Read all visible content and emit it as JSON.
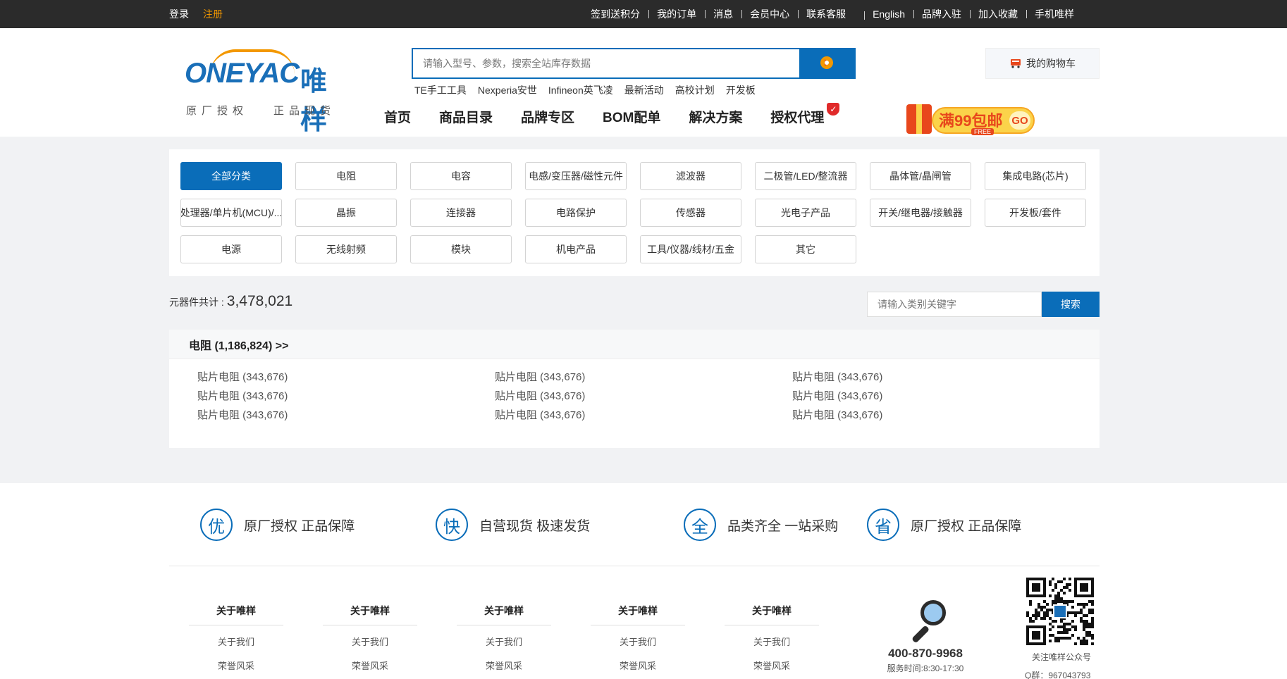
{
  "topbar": {
    "login": "登录",
    "register": "注册",
    "links": [
      "签到送积分",
      "我的订单",
      "消息",
      "会员中心",
      "联系客服",
      "English",
      "品牌入驻",
      "加入收藏",
      "手机唯样"
    ]
  },
  "logo": {
    "brand": "ONEYAC",
    "brand_cn": "唯样",
    "slogan_left": "原厂授权",
    "slogan_right": "正品现货"
  },
  "search": {
    "placeholder": "请输入型号、参数，搜索全站库存数据",
    "button_icon": "search-flame-icon",
    "hotwords": [
      "TE手工工具",
      "Nexperia安世",
      "Infineon英飞凌",
      "最新活动",
      "高校计划",
      "开发板"
    ]
  },
  "nav": {
    "items": [
      "首页",
      "商品目录",
      "品牌专区",
      "BOM配单",
      "解决方案",
      "授权代理"
    ]
  },
  "cart": {
    "label": "我的购物车",
    "icon": "shopping-cart-icon"
  },
  "promo": {
    "text": "满99包邮",
    "go": "GO",
    "free": "FREE"
  },
  "categories": [
    "全部分类",
    "电阻",
    "电容",
    "电感/变压器/磁性元件",
    "滤波器",
    "二极管/LED/整流器",
    "晶体管/晶闸管",
    "集成电路(芯片)",
    "处理器/单片机(MCU)/...",
    "晶振",
    "连接器",
    "电路保护",
    "传感器",
    "光电子产品",
    "开关/继电器/接触器",
    "开发板/套件",
    "电源",
    "无线射频",
    "模块",
    "机电产品",
    "工具/仪器/线材/五金",
    "其它"
  ],
  "summary": {
    "label": "元器件共计 :",
    "count": "3,478,021"
  },
  "category_search": {
    "placeholder": "请输入类别关键字",
    "button": "搜索"
  },
  "list": {
    "title": "电阻 (1,186,824) >>",
    "items": [
      "贴片电阻 (343,676)",
      "贴片电阻 (343,676)",
      "贴片电阻 (343,676)",
      "贴片电阻 (343,676)",
      "贴片电阻 (343,676)",
      "贴片电阻 (343,676)",
      "贴片电阻 (343,676)",
      "贴片电阻 (343,676)",
      "贴片电阻 (343,676)"
    ]
  },
  "features": [
    {
      "icon": "优",
      "text": "原厂授权 正品保障"
    },
    {
      "icon": "快",
      "text": "自营现货 极速发货"
    },
    {
      "icon": "全",
      "text": "品类齐全 一站采购"
    },
    {
      "icon": "省",
      "text": "原厂授权 正品保障"
    }
  ],
  "footer": {
    "columns": [
      {
        "title": "关于唯样",
        "links": [
          "关于我们",
          "荣誉风采"
        ]
      },
      {
        "title": "关于唯样",
        "links": [
          "关于我们",
          "荣誉风采"
        ]
      },
      {
        "title": "关于唯样",
        "links": [
          "关于我们",
          "荣誉风采"
        ]
      },
      {
        "title": "关于唯样",
        "links": [
          "关于我们",
          "荣誉风采"
        ]
      },
      {
        "title": "关于唯样",
        "links": [
          "关于我们",
          "荣誉风采"
        ]
      }
    ],
    "phone": "400-870-9968",
    "hours": "服务时间:8:30-17:30",
    "qr_caption": "关注唯样公众号",
    "qq": "Q群：967043793"
  },
  "colors": {
    "primary": "#0a6db9",
    "accent": "#f39800",
    "topbar": "#2b2b2b",
    "background": "#f1f2f4"
  }
}
